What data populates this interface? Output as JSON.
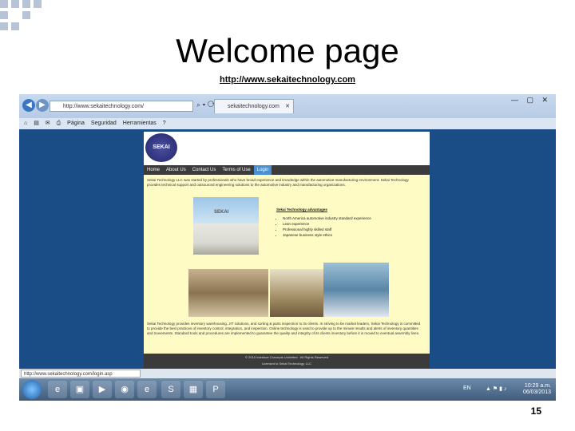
{
  "slide": {
    "title": "Welcome page",
    "url": "http://www.sekaitechnology.com",
    "page_number": "15"
  },
  "browser": {
    "address": "http://www.sekaitechnology.com/",
    "tab_title": "sekaitechnology.com",
    "toolbar": [
      "Página",
      "Seguridad",
      "Herramientas"
    ],
    "status_url": "http://www.sekaitechnology.com/login.asp"
  },
  "website": {
    "logo": "SEKAI",
    "nav": [
      "Home",
      "About Us",
      "Contact Us",
      "Terms of Use",
      "Login"
    ],
    "intro": "Sekai Technology LLC was started by professionals who have broad experience and knowledge within the automotive manufacturing environment. Sekai Technology provides technical support and outsourced engineering solutions to the automotive industry and manufacturing organizations.",
    "factory_sign": "SEKAI",
    "advantages_heading": "Sekai Technology advantages",
    "advantages": [
      "North America automotive industry standard experience",
      "Lean experience",
      "Professional highly skilled staff",
      "Japanese business style ethics"
    ],
    "body2": "Sekai Technology provides inventory warehousing, JIT solutions, and sorting & parts inspection to its clients. In striving to be market leaders, Sekai Technology is committed to provide the best practices of inventory control, integration, and inspection. Online technology is used to provide up to the minute results and alerts of inventory quantities and movements. Standard tools and procedures are implemented to guarantee the quality and integrity of its clients inventory before it is moved to eventual assembly lines.",
    "footer_line1": "© 2010 Interface Concepts Unlimited · All Rights Reserved",
    "footer_line2": "Licensed to Sekai Technology, LLC"
  },
  "taskbar": {
    "lang": "EN",
    "time": "10:29 a.m.",
    "date": "06/03/2013"
  }
}
